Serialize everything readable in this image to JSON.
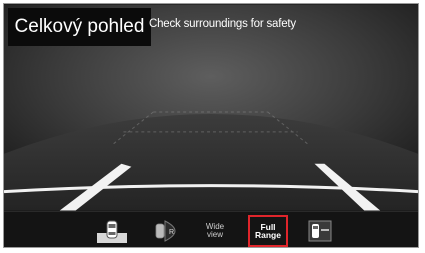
{
  "view_title": "Celkový pohled",
  "notice": "Check surroundings for safety",
  "bottom_bar": {
    "buttons": [
      {
        "id": "top-view",
        "label": ""
      },
      {
        "id": "rear-view",
        "label": "R"
      },
      {
        "id": "wide-view",
        "label_line1": "Wide",
        "label_line2": "view"
      },
      {
        "id": "full-range",
        "label_line1": "Full",
        "label_line2": "Range",
        "selected": true
      },
      {
        "id": "side-view",
        "label": ""
      }
    ]
  },
  "colors": {
    "background": "#161616",
    "guideline": "#f2f2f2",
    "selected_border": "#e0252b",
    "text": "#ffffff"
  }
}
